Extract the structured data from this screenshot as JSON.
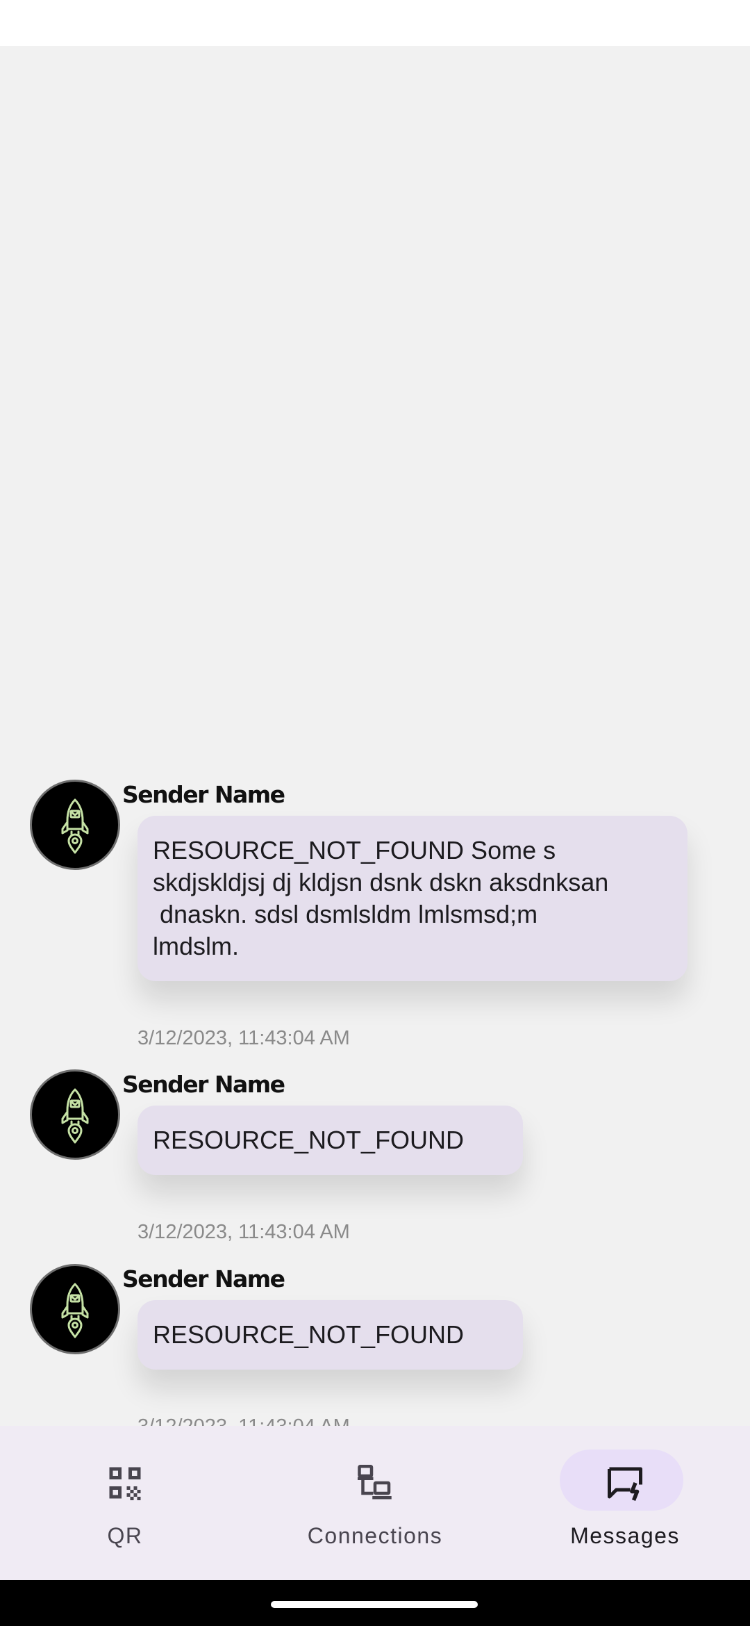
{
  "messages": [
    {
      "sender": "Sender Name",
      "lines": [
        "RESOURCE_NOT_FOUND Some s",
        "skdjskldjsj dj kldjsn dsnk dskn aksdnksan",
        " dnaskn. sdsl dsmlsldm lmlsmsd;m",
        "lmdslm."
      ],
      "timestamp": "3/12/2023, 11:43:04 AM"
    },
    {
      "sender": "Sender Name",
      "lines": [
        "RESOURCE_NOT_FOUND"
      ],
      "timestamp": "3/12/2023, 11:43:04 AM"
    },
    {
      "sender": "Sender Name",
      "lines": [
        "RESOURCE_NOT_FOUND"
      ],
      "timestamp": "3/12/2023, 11:43:04 AM"
    }
  ],
  "nav": {
    "items": [
      {
        "label": "QR",
        "icon": "qr-code-icon",
        "active": false
      },
      {
        "label": "Connections",
        "icon": "devices-icon",
        "active": false
      },
      {
        "label": "Messages",
        "icon": "chat-bolt-icon",
        "active": true
      }
    ]
  },
  "colors": {
    "background": "#f1f1f1",
    "bubble": "#e5dfed",
    "nav_background": "#f0ebf4",
    "nav_active_pill": "#e8def8",
    "avatar_icon": "#c5e1a5"
  }
}
